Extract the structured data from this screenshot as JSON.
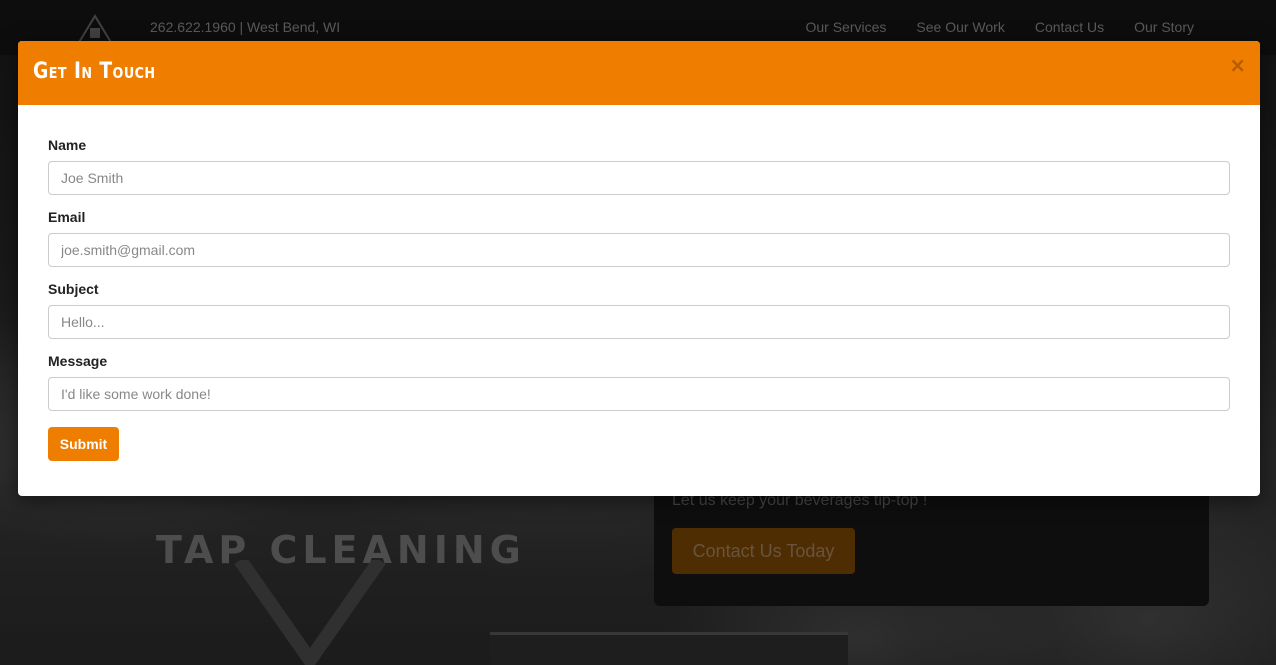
{
  "background": {
    "contact_line": "262.622.1960 | West Bend, WI",
    "nav": [
      "Our Services",
      "See Our Work",
      "Contact Us",
      "Our Story"
    ],
    "hero_brand": "TAP CLEANING",
    "cta_text": "Let us keep your beverages tip-top !",
    "cta_button": "Contact Us Today"
  },
  "modal": {
    "title": "Get In Touch",
    "close_label": "×",
    "fields": [
      {
        "label": "Name",
        "placeholder": "Joe Smith"
      },
      {
        "label": "Email",
        "placeholder": "joe.smith@gmail.com"
      },
      {
        "label": "Subject",
        "placeholder": "Hello..."
      },
      {
        "label": "Message",
        "placeholder": "I'd like some work done!"
      }
    ],
    "submit_label": "Submit"
  },
  "colors": {
    "accent": "#ef7d00",
    "dark": "#141414"
  },
  "icons": [
    "tap-logo-icon",
    "close-icon"
  ]
}
